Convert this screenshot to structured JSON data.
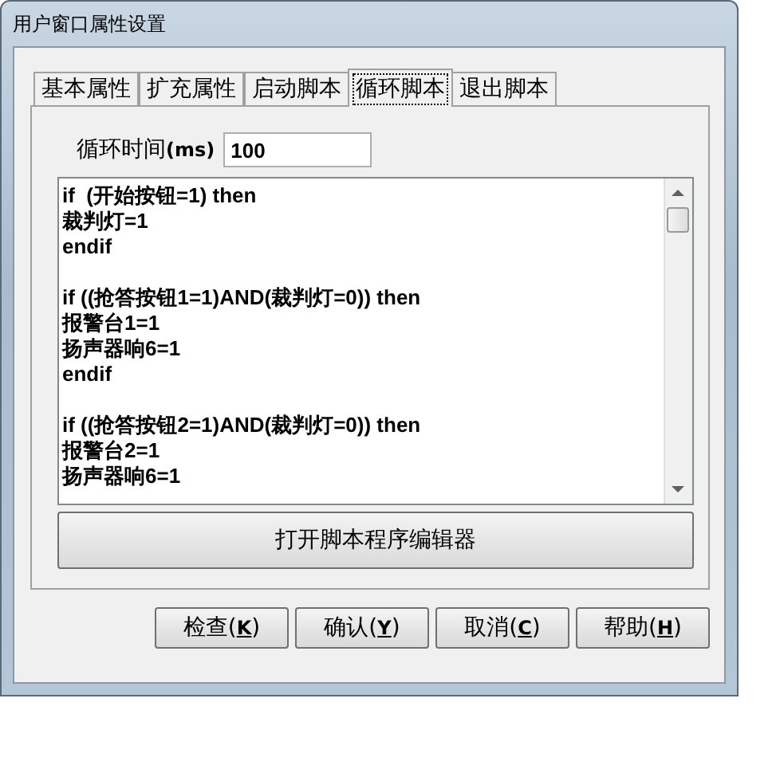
{
  "window": {
    "title": "用户窗口属性设置"
  },
  "tabs": [
    {
      "label": "基本属性",
      "selected": false
    },
    {
      "label": "扩充属性",
      "selected": false
    },
    {
      "label": "启动脚本",
      "selected": false
    },
    {
      "label": "循环脚本",
      "selected": true
    },
    {
      "label": "退出脚本",
      "selected": false
    }
  ],
  "cycle_time": {
    "label": "循环时间",
    "unit": "(ms)",
    "value": "100"
  },
  "script_blocks": [
    [
      "if  (开始按钮=1) then",
      "裁判灯=1",
      "endif"
    ],
    [
      "if ((抢答按钮1=1)AND(裁判灯=0)) then",
      "报警台1=1",
      "扬声器响6=1",
      "endif"
    ],
    [
      "if ((抢答按钮2=1)AND(裁判灯=0)) then",
      "报警台2=1",
      "扬声器响6=1"
    ]
  ],
  "editor_button": "打开脚本程序编辑器",
  "buttons": [
    {
      "prefix": "检查(",
      "accelerator": "K",
      "suffix": ")"
    },
    {
      "prefix": "确认(",
      "accelerator": "Y",
      "suffix": ")"
    },
    {
      "prefix": "取消(",
      "accelerator": "C",
      "suffix": ")"
    },
    {
      "prefix": "帮助(",
      "accelerator": "H",
      "suffix": ")"
    }
  ]
}
